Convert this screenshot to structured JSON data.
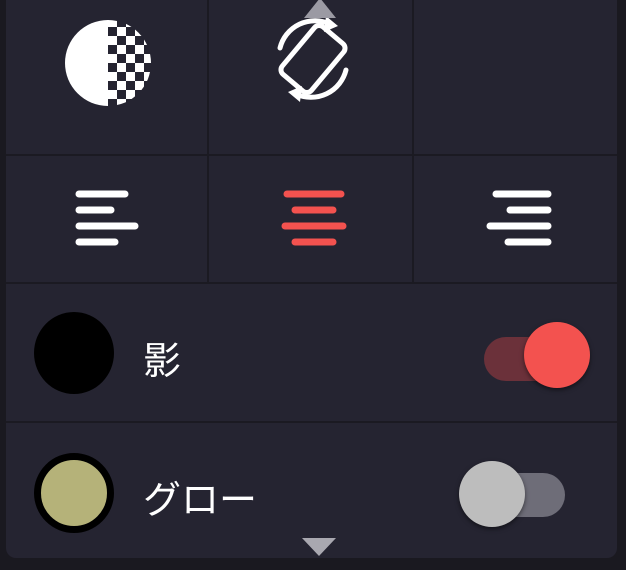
{
  "icons": {
    "opacity": "opacity-icon",
    "rotate": "rotate-icon",
    "align_left": "align-left-icon",
    "align_center": "align-center-icon",
    "align_right": "align-right-icon"
  },
  "alignment": {
    "selected": "center"
  },
  "options": [
    {
      "label": "影",
      "swatch_color": "#000000",
      "enabled": true
    },
    {
      "label": "グロー",
      "swatch_color": "#b5b279",
      "enabled": false
    }
  ],
  "colors": {
    "accent": "#f3524f",
    "background": "#252431",
    "icon": "#ffffff"
  }
}
